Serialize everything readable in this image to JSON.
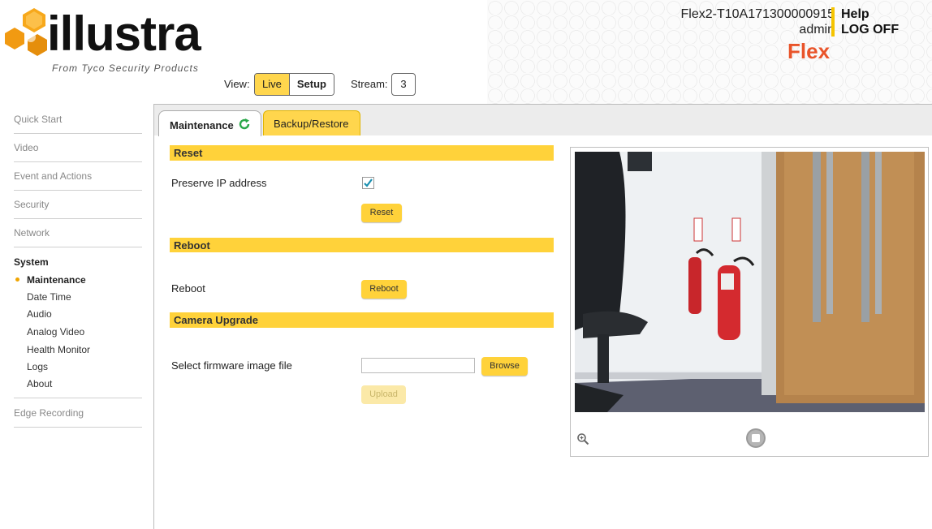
{
  "header": {
    "logo_text": "illustra",
    "logo_subtitle": "From Tyco Security Products",
    "device_name": "Flex2-T10A171300000915",
    "user": "admin",
    "help": "Help",
    "log_off": "LOG OFF",
    "product": "Flex",
    "view_label": "View:",
    "view_live": "Live",
    "view_setup": "Setup",
    "stream_label": "Stream:",
    "stream_value": "3"
  },
  "sidebar": {
    "items": [
      {
        "label": "Quick Start"
      },
      {
        "label": "Video"
      },
      {
        "label": "Event and Actions"
      },
      {
        "label": "Security"
      },
      {
        "label": "Network"
      },
      {
        "label": "System"
      },
      {
        "label": "Edge Recording"
      }
    ],
    "system_subitems": [
      {
        "label": "Maintenance",
        "active": true
      },
      {
        "label": "Date Time"
      },
      {
        "label": "Audio"
      },
      {
        "label": "Analog Video"
      },
      {
        "label": "Health Monitor"
      },
      {
        "label": "Logs"
      },
      {
        "label": "About"
      }
    ]
  },
  "tabs": {
    "maintenance": "Maintenance",
    "backup_restore": "Backup/Restore"
  },
  "reset_section": {
    "title": "Reset",
    "preserve_ip_label": "Preserve IP address",
    "preserve_ip_checked": true,
    "reset_button": "Reset"
  },
  "reboot_section": {
    "title": "Reboot",
    "reboot_label": "Reboot",
    "reboot_button": "Reboot"
  },
  "upgrade_section": {
    "title": "Camera Upgrade",
    "select_label": "Select firmware image file",
    "file_value": "",
    "browse_button": "Browse",
    "upload_button": "Upload"
  },
  "colors": {
    "accent_yellow": "#ffd23a",
    "brand_orange": "#f5a300",
    "flex_red": "#e9542a"
  }
}
